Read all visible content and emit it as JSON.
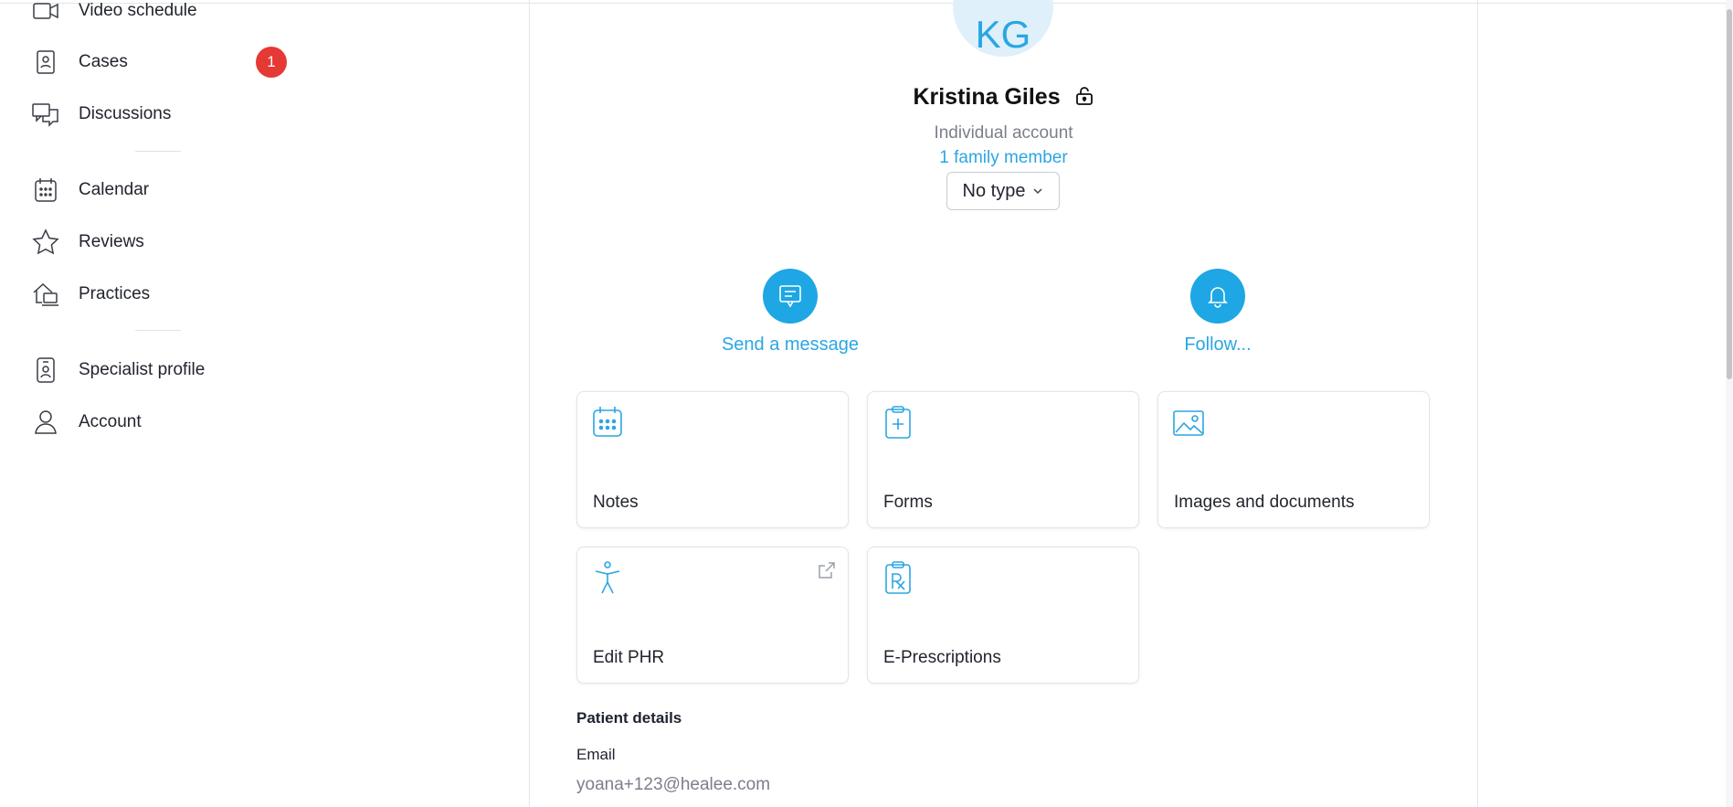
{
  "sidebar": {
    "items": [
      {
        "label": "Video schedule",
        "icon": "video-icon"
      },
      {
        "label": "Cases",
        "icon": "cases-icon",
        "badge": "1"
      },
      {
        "label": "Discussions",
        "icon": "discussions-icon"
      },
      {
        "label": "Calendar",
        "icon": "calendar-icon"
      },
      {
        "label": "Reviews",
        "icon": "star-icon"
      },
      {
        "label": "Practices",
        "icon": "practices-icon"
      },
      {
        "label": "Specialist profile",
        "icon": "specialist-profile-icon"
      },
      {
        "label": "Account",
        "icon": "account-icon"
      }
    ]
  },
  "profile": {
    "initials": "KG",
    "name": "Kristina Giles",
    "account_type": "Individual account",
    "family_link": "1 family member",
    "type_select": "No type"
  },
  "actions": {
    "message": "Send a message",
    "follow": "Follow..."
  },
  "cards": {
    "notes": "Notes",
    "forms": "Forms",
    "images": "Images and documents",
    "phr": "Edit PHR",
    "prescriptions": "E-Prescriptions"
  },
  "details": {
    "title": "Patient details",
    "email_label": "Email",
    "email_value": "yoana+123@healee.com"
  },
  "colors": {
    "accent": "#1ea7e4",
    "badge": "#e53935",
    "avatar_bg": "#dff0fb"
  }
}
